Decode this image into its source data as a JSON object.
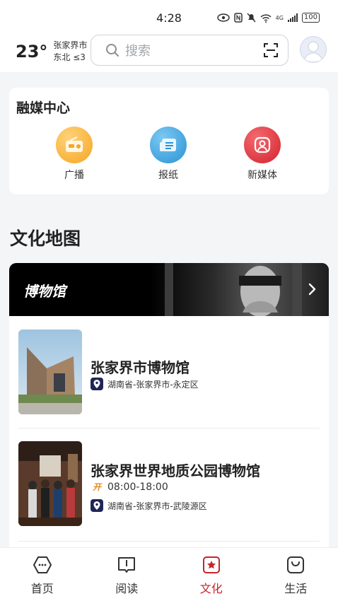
{
  "status": {
    "time": "4:28",
    "battery": "100",
    "network": "4G"
  },
  "weather": {
    "temperature": "23°",
    "city": "张家界市",
    "wind": "东北  ≤3"
  },
  "search": {
    "placeholder": "搜索"
  },
  "media_center": {
    "title": "融媒中心",
    "items": [
      {
        "label": "广播",
        "icon": "radio-icon",
        "color": "#f5a623"
      },
      {
        "label": "报纸",
        "icon": "newspaper-icon",
        "color": "#2a93d5"
      },
      {
        "label": "新媒体",
        "icon": "new-media-icon",
        "color": "#d3232e"
      }
    ]
  },
  "culture_map": {
    "title": "文化地图",
    "banner_title": "博物馆",
    "museums": [
      {
        "name": "张家界市博物馆",
        "location": "湖南省-张家界市-永定区"
      },
      {
        "name": "张家界世界地质公园博物馆",
        "hours_badge": "开",
        "hours": "08:00-18:00",
        "location": "湖南省-张家界市-武陵源区"
      }
    ]
  },
  "bottom_nav": [
    {
      "label": "首页",
      "icon": "home-icon"
    },
    {
      "label": "阅读",
      "icon": "book-icon"
    },
    {
      "label": "文化",
      "icon": "culture-icon",
      "active": true
    },
    {
      "label": "生活",
      "icon": "bag-icon"
    }
  ],
  "colors": {
    "accent": "#c8242b",
    "location_badge": "#1f2656"
  }
}
